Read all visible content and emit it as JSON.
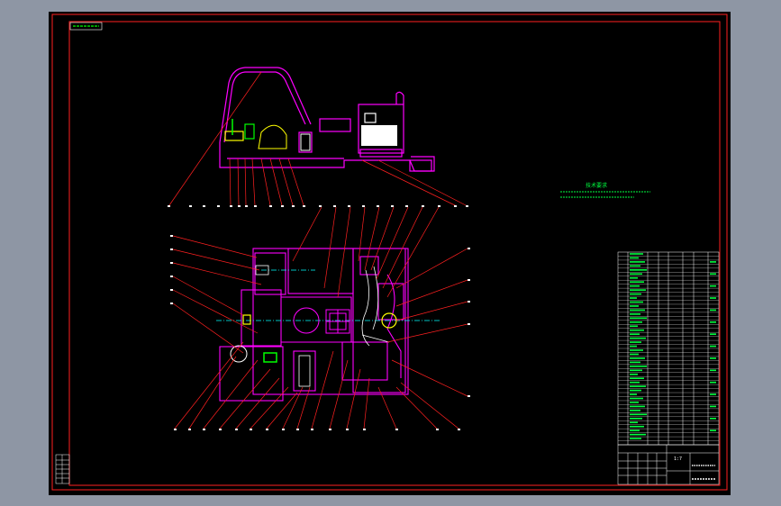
{
  "colors": {
    "background": "#000000",
    "border": "#ff2020",
    "frame": "#ff2020",
    "outline": "#ff00ff",
    "leader": "#ff2020",
    "text": "#ffffff",
    "notes": "#00ff40",
    "centerline": "#00ffff",
    "component_white": "#ffffff",
    "component_green": "#00ff00",
    "component_yellow": "#ffff00"
  },
  "title_block": {
    "scale": "1:7",
    "title": "",
    "drawing_no": ""
  },
  "tech_notes": {
    "title": "技术要求",
    "lines": []
  },
  "icons": {
    "corner_tag": "stamp-box",
    "bom_table": "parts-list-table",
    "revision_table": "revision-table"
  }
}
